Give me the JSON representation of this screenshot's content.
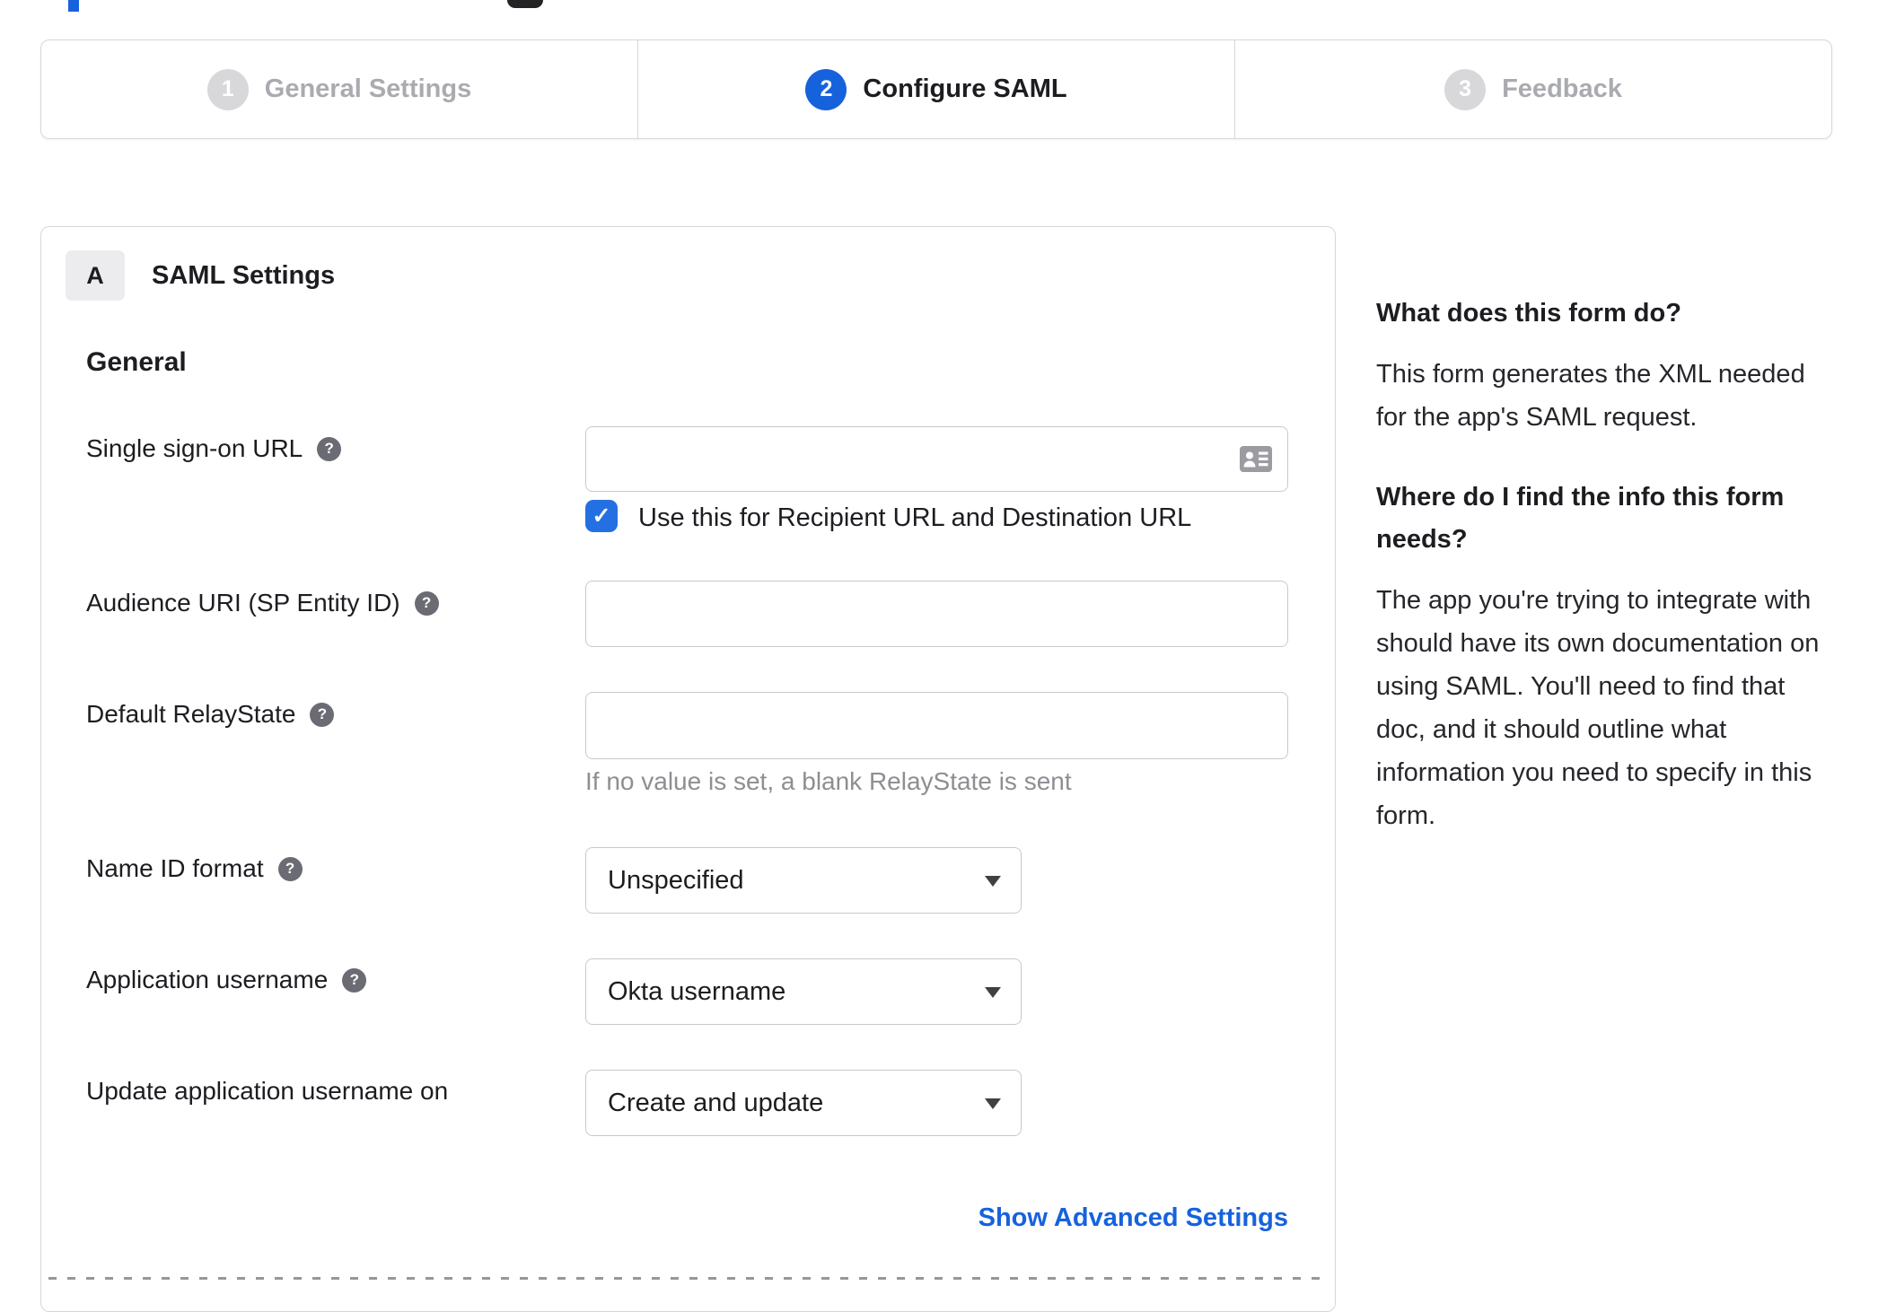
{
  "stepper": {
    "steps": [
      {
        "number": "1",
        "label": "General Settings"
      },
      {
        "number": "2",
        "label": "Configure SAML"
      },
      {
        "number": "3",
        "label": "Feedback"
      }
    ]
  },
  "panel": {
    "section_badge": "A",
    "section_title": "SAML Settings",
    "group_title": "General",
    "fields": {
      "sso": {
        "label": "Single sign-on URL",
        "value": ""
      },
      "sso_checkbox": {
        "label": "Use this for Recipient URL and Destination URL",
        "checked": true
      },
      "audience": {
        "label": "Audience URI (SP Entity ID)",
        "value": ""
      },
      "relay": {
        "label": "Default RelayState",
        "value": "",
        "helper": "If no value is set, a blank RelayState is sent"
      },
      "name_id": {
        "label": "Name ID format",
        "value": "Unspecified"
      },
      "app_username": {
        "label": "Application username",
        "value": "Okta username"
      },
      "update_username": {
        "label": "Update application username on",
        "value": "Create and update"
      }
    },
    "advanced_link": "Show Advanced Settings"
  },
  "sidebar": {
    "heading1": "What does this form do?",
    "body1": "This form generates the XML needed for the app's SAML request.",
    "heading2": "Where do I find the info this form needs?",
    "body2": "The app you're trying to integrate with should have its own documentation on using SAML. You'll need to find that doc, and it should outline what information you need to specify in this form."
  },
  "icons": {
    "help": "?",
    "check": "✓"
  },
  "colors": {
    "accent_blue": "#1662dd",
    "checkbox_blue": "#2470e2",
    "link_blue": "#1662dd",
    "inactive_gray": "#d8d8db",
    "border_gray": "#d7d7da"
  }
}
